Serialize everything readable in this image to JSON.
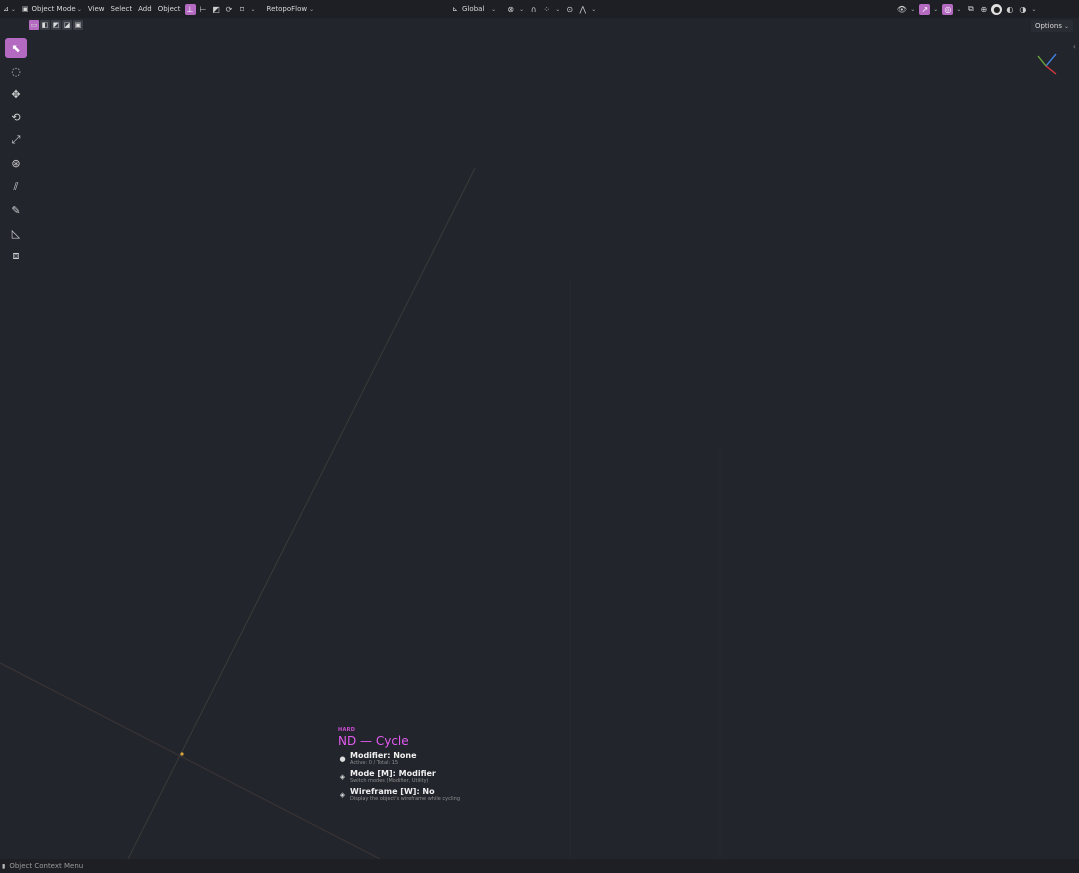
{
  "header": {
    "mode_label": "Object Mode",
    "menus": [
      "View",
      "Select",
      "Add",
      "Object"
    ],
    "retopoflow_label": "RetopoFlow",
    "transform_orientation": "Global"
  },
  "options_label": "Options",
  "toolbar": {
    "tools": [
      "select-box",
      "cursor",
      "move",
      "rotate",
      "scale",
      "transform",
      "annotate",
      "annotate-line",
      "measure",
      "add-cube"
    ]
  },
  "overlay": {
    "app_tag": "HARD",
    "title": "ND — Cycle",
    "items": [
      {
        "label": "Modifier: None",
        "sub": "Active: 0  /  Total: 15"
      },
      {
        "label": "Mode [M]: Modifier",
        "sub": "Switch modes (Modifier, Utility)"
      },
      {
        "label": "Wireframe [W]: No",
        "sub": "Display the object's wireframe while cycling"
      }
    ]
  },
  "status": {
    "text": "Object Context Menu"
  },
  "colors": {
    "accent": "#b36ac0",
    "overlay_title": "#e35af0",
    "background": "#23252d",
    "origin_point": "#d9a23b"
  }
}
